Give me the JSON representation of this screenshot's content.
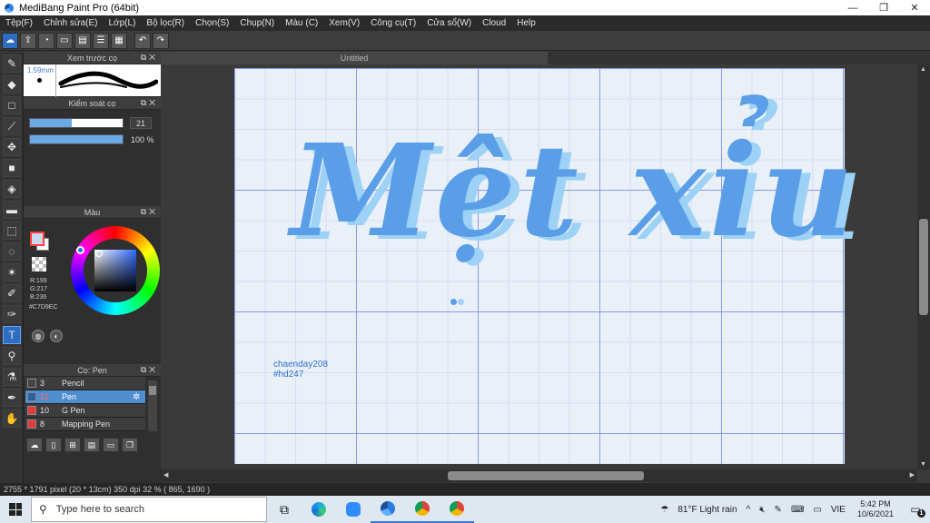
{
  "window": {
    "title": "MediBang Paint Pro (64bit)",
    "controls": {
      "minimize": "—",
      "restore": "❐",
      "close": "✕"
    }
  },
  "menu": [
    "Tệp(F)",
    "Chỉnh sửa(E)",
    "Lớp(L)",
    "Bộ lọc(R)",
    "Chọn(S)",
    "Chụp(N)",
    "Màu (C)",
    "Xem(V)",
    "Công cụ(T)",
    "Cửa sổ(W)",
    "Cloud",
    "Help"
  ],
  "toolbar": {
    "icons": [
      "cloud-icon",
      "share-icon",
      "comment-icon",
      "chat-icon",
      "page-icon",
      "list-icon",
      "grid-icon"
    ],
    "undo": "↶",
    "redo": "↷"
  },
  "panels": {
    "brush_preview": {
      "title": "Xem trước cọ",
      "size": "1.59mm"
    },
    "brush_control": {
      "title": "Kiểm soát cọ",
      "size_value": "21",
      "opacity_value": "100 %",
      "size_fraction": 0.45,
      "opacity_fraction": 1.0
    },
    "color": {
      "title": "Màu",
      "r": "R:199",
      "g": "G:217",
      "b": "B:236",
      "hex": "#C7D9EC",
      "current": "#c7d9ec"
    },
    "brush_list": {
      "title": "Cọ: Pen",
      "items": [
        {
          "num": "3",
          "name": "Pencil",
          "swatch": "#444444"
        },
        {
          "num": "21",
          "name": "Pen",
          "swatch": "#2b5f9e"
        },
        {
          "num": "10",
          "name": "G Pen",
          "swatch": "#e23b3b"
        },
        {
          "num": "8",
          "name": "Mapping Pen",
          "swatch": "#e23b3b"
        }
      ]
    }
  },
  "document": {
    "tab": "Untitled",
    "artwork_text": "Mệt xỉu",
    "signature_line1": "chaenday208",
    "signature_line2": "#hd247",
    "colors": {
      "main": "#5b9ee8",
      "shadow": "#9dd2f6"
    }
  },
  "status": "2755 * 1791 pixel   (20 * 13cm)   350 dpi   32 %   ( 865, 1690 )",
  "taskbar": {
    "search_placeholder": "Type here to search",
    "weather": "81°F  Light rain",
    "lang": "VIE",
    "time": "5:42 PM",
    "date": "10/6/2021",
    "notifications": "1"
  }
}
